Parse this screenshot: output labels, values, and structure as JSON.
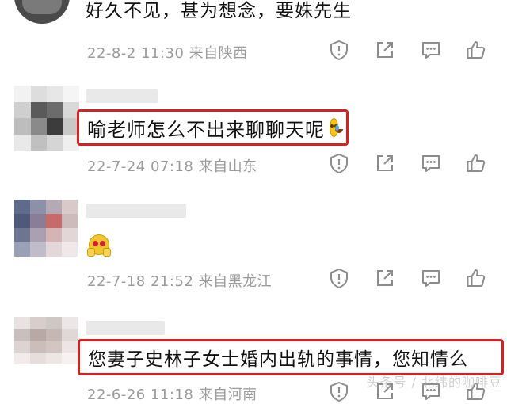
{
  "comments": [
    {
      "text": "好久不见，甚为想念，要姝先生",
      "time": "22-8-2 11:30",
      "location": "来自陕西"
    },
    {
      "text": "喻老师怎么不出来聊聊天呢",
      "time": "22-7-24 07:18",
      "location": "来自山东"
    },
    {
      "text": "",
      "time": "22-7-18 21:52",
      "location": "来自黑龙江"
    },
    {
      "text": "您妻子史林子女士婚内出轨的事情，您知情么",
      "time": "22-6-26 11:18",
      "location": "来自河南"
    }
  ],
  "actions": [
    "report-icon",
    "share-icon",
    "comment-icon",
    "like-icon"
  ],
  "watermark": "头条号 / 北纬的咖啡豆",
  "colors": {
    "highlight_box": "#d9201f",
    "meta_text": "#9b9b9b",
    "icon_stroke": "#8c8c8c"
  }
}
